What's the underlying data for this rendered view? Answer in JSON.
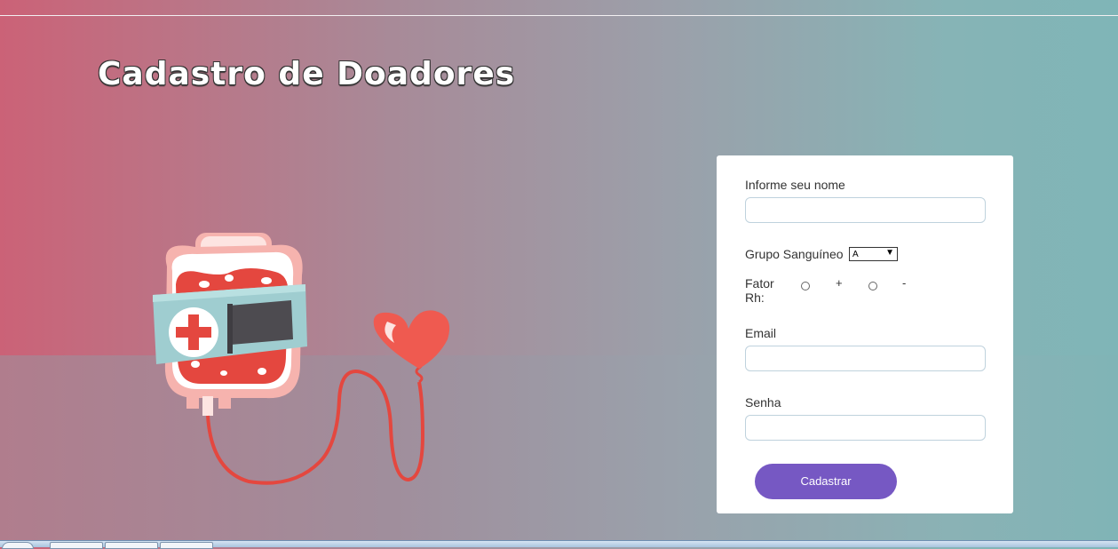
{
  "page": {
    "title": "Cadastro de Doadores"
  },
  "form": {
    "name_label": "Informe seu nome",
    "name_value": "",
    "blood_group_label": "Grupo Sanguíneo",
    "blood_group_selected": "A",
    "rh_label_line1": "Fator",
    "rh_label_line2": "Rh:",
    "rh_options": [
      "+",
      "-"
    ],
    "email_label": "Email",
    "email_value": "",
    "password_label": "Senha",
    "password_value": "",
    "submit_label": "Cadastrar"
  },
  "colors": {
    "button": "#7658c3",
    "gradient_left": "#cb6277",
    "gradient_right": "#7fb5b7"
  },
  "icons": {
    "illustration": "blood-bag-heart-illustration"
  }
}
